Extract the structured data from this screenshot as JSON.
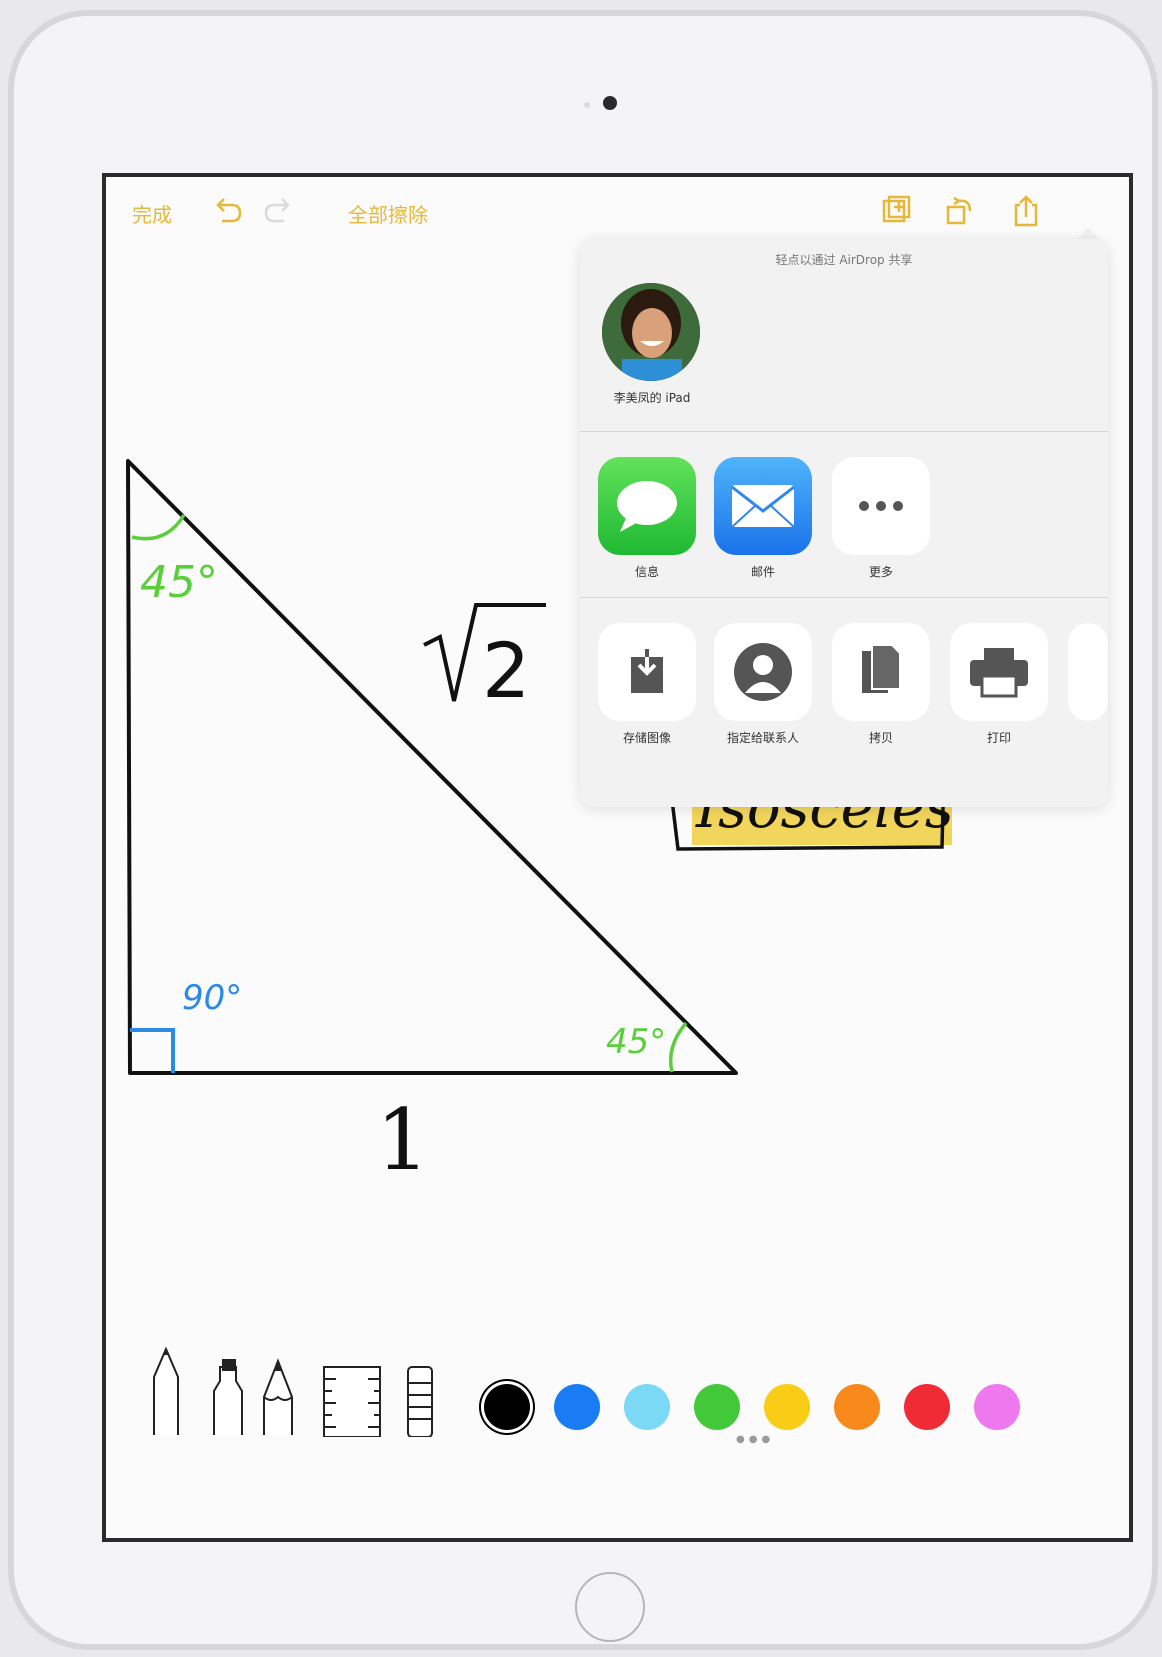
{
  "toolbar": {
    "done_label": "完成",
    "erase_all_label": "全部擦除"
  },
  "share_sheet": {
    "airdrop_hint": "轻点以通过 AirDrop 共享",
    "airdrop_device": "李美凤的 iPad",
    "share_apps": [
      {
        "label": "信息",
        "icon": "messages-icon"
      },
      {
        "label": "邮件",
        "icon": "mail-icon"
      },
      {
        "label": "更多",
        "icon": "more-icon"
      }
    ],
    "actions": [
      {
        "label": "存储图像",
        "icon": "save-image-icon"
      },
      {
        "label": "指定给联系人",
        "icon": "contact-icon"
      },
      {
        "label": "拷贝",
        "icon": "copy-icon"
      },
      {
        "label": "打印",
        "icon": "print-icon"
      }
    ]
  },
  "drawing": {
    "angle_top": "45°",
    "angle_bottom_left": "90°",
    "angle_bottom_right": "45°",
    "hypotenuse_label": "√2",
    "base_label": "1",
    "note_label": "Isosceles"
  },
  "palette": {
    "tools": [
      "pen-tool-icon",
      "marker-tool-icon",
      "pencil-tool-icon",
      "ruler-tool-icon",
      "eraser-tool-icon"
    ],
    "colors": [
      "#000000",
      "#1a7cf5",
      "#7bd9f6",
      "#43c83a",
      "#f9cc16",
      "#f88a1b",
      "#f02b36",
      "#ee78ee"
    ],
    "selected_color": "#000000"
  },
  "accent_color": "#e6b83a"
}
